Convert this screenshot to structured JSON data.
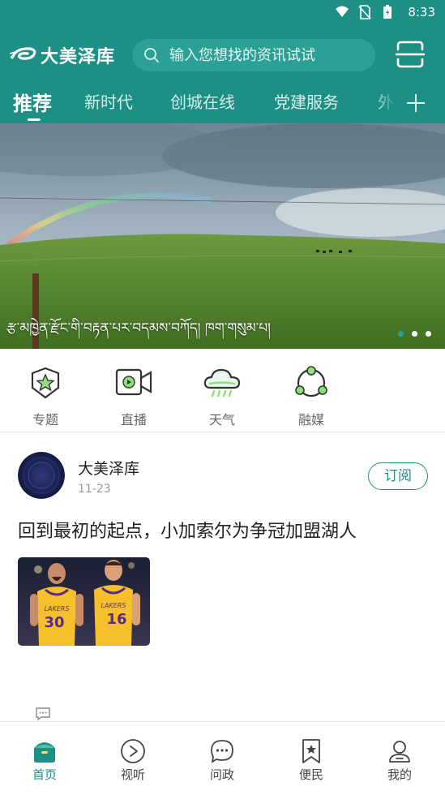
{
  "status": {
    "time": "8:33"
  },
  "header": {
    "logo_text": "大美泽库",
    "search_placeholder": "输入您想找的资讯试试",
    "tabs": [
      {
        "label": "推荐",
        "active": true
      },
      {
        "label": "新时代"
      },
      {
        "label": "创城在线"
      },
      {
        "label": "党建服务"
      },
      {
        "label": "外"
      }
    ]
  },
  "banner": {
    "caption": "རྩ་མཁྱེན་རྫོང་གི་བརྟན་པར་བདམས་བཀོད། ཁག་གསུམ་པ།",
    "page_count": 3,
    "active_page": 1
  },
  "shortcuts": [
    {
      "label": "专题",
      "icon": "topic-star-icon"
    },
    {
      "label": "直播",
      "icon": "live-video-icon"
    },
    {
      "label": "天气",
      "icon": "weather-cloud-icon"
    },
    {
      "label": "融媒",
      "icon": "media-network-icon"
    }
  ],
  "feed": {
    "author": "大美泽库",
    "date": "11-23",
    "subscribe_label": "订阅",
    "headline": "回到最初的起点，小加索尔为争冠加盟湖人",
    "thumb_jerseys": [
      "30",
      "16"
    ],
    "thumb_team": "LAKERS"
  },
  "bottom_nav": [
    {
      "label": "首页",
      "icon": "home-icon",
      "active": true
    },
    {
      "label": "视听",
      "icon": "play-icon"
    },
    {
      "label": "问政",
      "icon": "chat-icon"
    },
    {
      "label": "便民",
      "icon": "bookmark-star-icon"
    },
    {
      "label": "我的",
      "icon": "user-icon"
    }
  ],
  "colors": {
    "brand": "#1d8f85",
    "brand_light": "#2aa096",
    "text": "#222222",
    "muted": "#999999"
  }
}
